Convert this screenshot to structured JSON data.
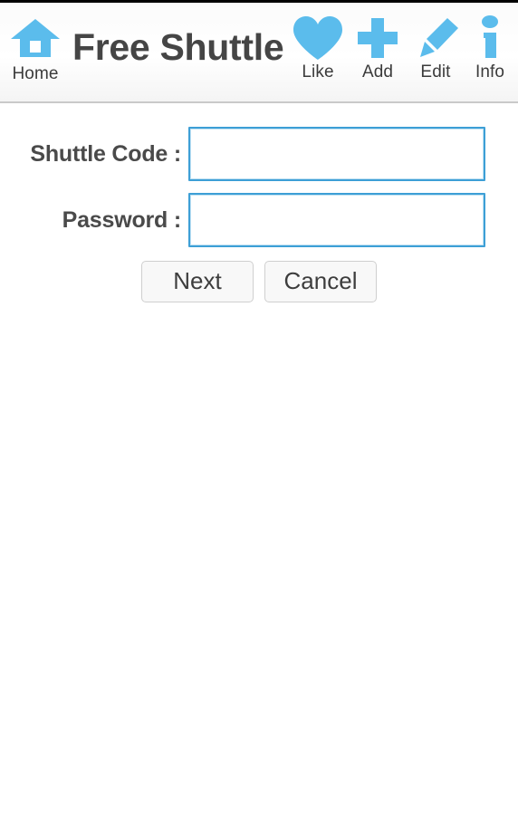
{
  "app": {
    "title": "Free Shuttle",
    "accent_color": "#5bbcec",
    "title_color": "#454545",
    "input_border_color": "#3d9fd6"
  },
  "header": {
    "home": {
      "label": "Home",
      "icon": "home-icon"
    },
    "actions": [
      {
        "label": "Like",
        "icon": "heart-icon"
      },
      {
        "label": "Add",
        "icon": "plus-icon"
      },
      {
        "label": "Edit",
        "icon": "pencil-icon"
      },
      {
        "label": "Info",
        "icon": "info-icon"
      }
    ]
  },
  "form": {
    "shuttle_code": {
      "label": "Shuttle Code :",
      "value": "",
      "placeholder": ""
    },
    "password": {
      "label": "Password :",
      "value": "",
      "placeholder": ""
    }
  },
  "buttons": {
    "next": "Next",
    "cancel": "Cancel"
  }
}
